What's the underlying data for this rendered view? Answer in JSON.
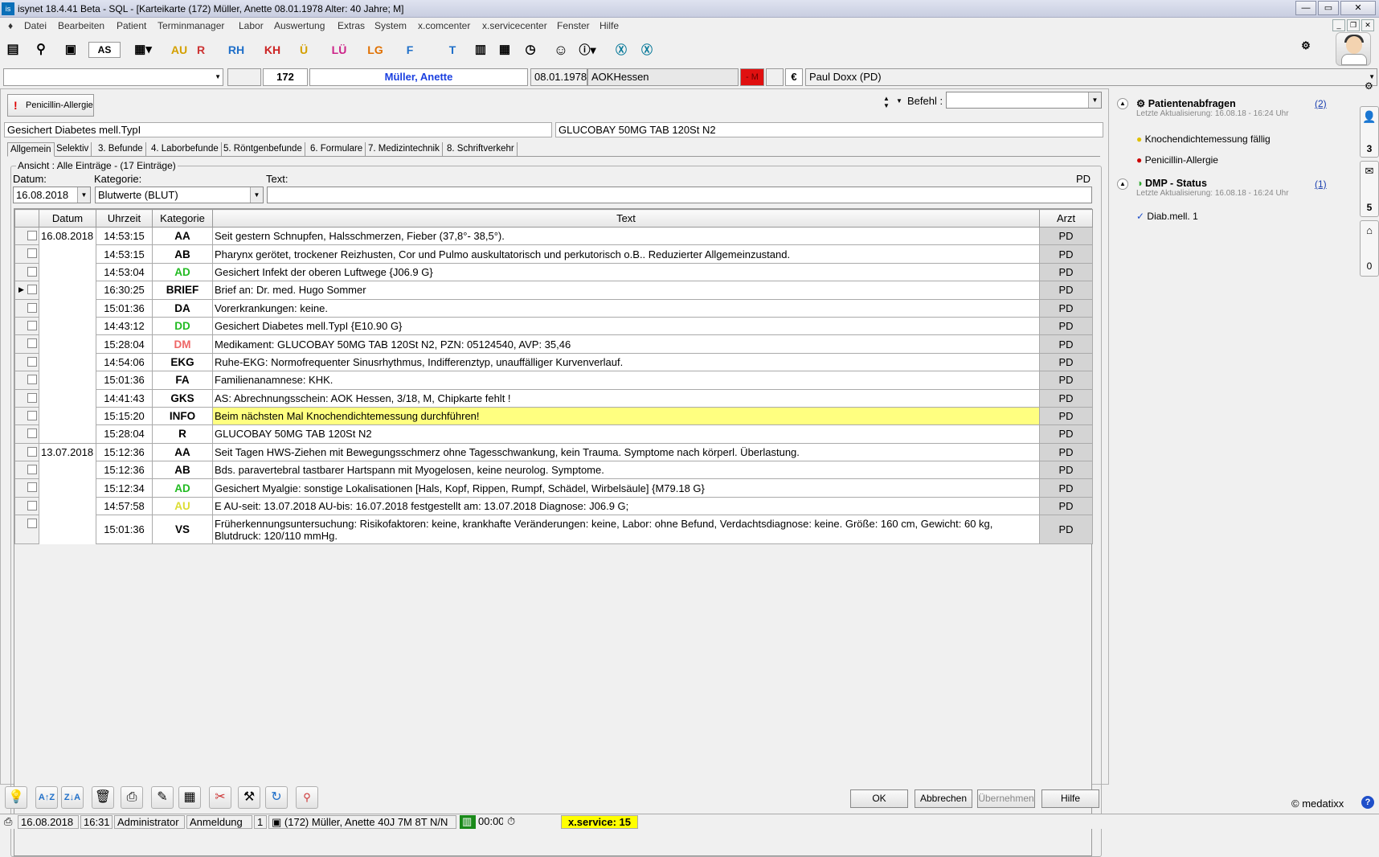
{
  "window": {
    "title": "isynet 18.4.41 Beta - SQL - [Karteikarte (172) Müller, Anette 08.01.1978 Alter: 40 Jahre; M]",
    "app_icon": "isynet-logo"
  },
  "menu": [
    "Datei",
    "Bearbeiten",
    "Patient",
    "Terminmanager",
    "Labor",
    "Auswertung",
    "Extras",
    "System",
    "x.comcenter",
    "x.servicecenter",
    "Fenster",
    "Hilfe"
  ],
  "toolbar": {
    "au": "AU",
    "r": "R",
    "rh": "RH",
    "kh": "KH",
    "u": "Ü",
    "lu": "LÜ",
    "lg": "LG",
    "f": "F",
    "as": "AS",
    "t": "T"
  },
  "patient": {
    "number": "172",
    "name": "Müller, Anette",
    "dob": "08.01.1978",
    "insurance": "AOKHessen",
    "sex_flag": "- M",
    "euro": "€",
    "doctor": "Paul Doxx (PD)"
  },
  "allergy_button": "Penicillin-Allergie",
  "befehl_label": "Befehl :",
  "diagnosis_left": "Gesichert Diabetes mell.TypI",
  "diagnosis_right": "GLUCOBAY 50MG TAB 120St N2",
  "tabs": [
    "Allgemein",
    "Selektiv",
    "3. Befunde",
    "4. Laborbefunde",
    "5. Röntgenbefunde",
    "6. Formulare",
    "7. Medizintechnik",
    "8. Schriftverkehr"
  ],
  "view_label": "Ansicht : Alle Einträge - (17 Einträge)",
  "filter": {
    "datum_label": "Datum:",
    "datum_value": "16.08.2018",
    "kategorie_label": "Kategorie:",
    "kategorie_value": "Blutwerte (BLUT)",
    "text_label": "Text:",
    "user_tag": "PD"
  },
  "table": {
    "headers": [
      "Datum",
      "Uhrzeit",
      "Kategorie",
      "Text",
      "Arzt"
    ],
    "rows": [
      {
        "date": "16.08.2018",
        "time": "14:53:15",
        "cat": "AA",
        "cat_color": "#000000",
        "text": "Seit gestern Schnupfen, Halsschmerzen, Fieber (37,8°- 38,5°).",
        "arzt": "PD"
      },
      {
        "date": "",
        "time": "14:53:15",
        "cat": "AB",
        "cat_color": "#000000",
        "text": "Pharynx gerötet, trockener Reizhusten, Cor und Pulmo auskultatorisch und perkutorisch o.B.. Reduzierter Allgemeinzustand.",
        "arzt": "PD"
      },
      {
        "date": "",
        "time": "14:53:04",
        "cat": "AD",
        "cat_color": "#22bb22",
        "text": "Gesichert Infekt der oberen Luftwege {J06.9 G}",
        "arzt": "PD"
      },
      {
        "date": "",
        "time": "16:30:25",
        "cat": "BRIEF",
        "cat_color": "#000000",
        "text": "Brief an: Dr. med. Hugo Sommer",
        "arzt": "PD"
      },
      {
        "date": "",
        "time": "15:01:36",
        "cat": "DA",
        "cat_color": "#000000",
        "text": "Vorerkrankungen: keine.",
        "arzt": "PD"
      },
      {
        "date": "",
        "time": "14:43:12",
        "cat": "DD",
        "cat_color": "#22bb22",
        "text": "Gesichert Diabetes mell.TypI {E10.90 G}",
        "arzt": "PD"
      },
      {
        "date": "",
        "time": "15:28:04",
        "cat": "DM",
        "cat_color": "#ee6666",
        "text": "Medikament: GLUCOBAY 50MG TAB 120St N2, PZN: 05124540, AVP:  35,46",
        "arzt": "PD"
      },
      {
        "date": "",
        "time": "14:54:06",
        "cat": "EKG",
        "cat_color": "#000000",
        "text": "Ruhe-EKG: Normofrequenter Sinusrhythmus, Indifferenztyp, unauffälliger Kurvenverlauf.",
        "arzt": "PD"
      },
      {
        "date": "",
        "time": "15:01:36",
        "cat": "FA",
        "cat_color": "#000000",
        "text": "Familienanamnese: KHK.",
        "arzt": "PD"
      },
      {
        "date": "",
        "time": "14:41:43",
        "cat": "GKS",
        "cat_color": "#000000",
        "text": "AS: Abrechnungsschein: AOK Hessen, 3/18, M, Chipkarte fehlt !",
        "arzt": "PD"
      },
      {
        "date": "",
        "time": "15:15:20",
        "cat": "INFO",
        "cat_color": "#000000",
        "text": "Beim nächsten Mal Knochendichtemessung durchführen!",
        "arzt": "PD"
      },
      {
        "date": "",
        "time": "15:28:04",
        "cat": "R",
        "cat_color": "#000000",
        "text": "GLUCOBAY 50MG TAB 120St N2",
        "arzt": "PD"
      },
      {
        "date": "13.07.2018",
        "time": "15:12:36",
        "cat": "AA",
        "cat_color": "#000000",
        "text": "Seit Tagen HWS-Ziehen mit Bewegungsschmerz ohne Tagesschwankung, kein Trauma. Symptome nach körperl. Überlastung.",
        "arzt": "PD"
      },
      {
        "date": "",
        "time": "15:12:36",
        "cat": "AB",
        "cat_color": "#000000",
        "text": "Bds. paravertebral tastbarer Hartspann mit Myogelosen, keine neurolog. Symptome.",
        "arzt": "PD"
      },
      {
        "date": "",
        "time": "15:12:34",
        "cat": "AD",
        "cat_color": "#22bb22",
        "text": "Gesichert Myalgie: sonstige Lokalisationen [Hals, Kopf, Rippen, Rumpf, Schädel, Wirbelsäule] {M79.18 G}",
        "arzt": "PD"
      },
      {
        "date": "",
        "time": "14:57:58",
        "cat": "AU",
        "cat_color": "#dddd33",
        "text": "E  AU-seit: 13.07.2018 AU-bis: 16.07.2018 festgestellt am: 13.07.2018 Diagnose: J06.9 G;",
        "arzt": "PD"
      },
      {
        "date": "",
        "time": "15:01:36",
        "cat": "VS",
        "cat_color": "#000000",
        "text": "Früherkennungsuntersuchung: Risikofaktoren: keine, krankhafte Veränderungen: keine, Labor: ohne Befund, Verdachtsdiagnose: keine. Größe: 160 cm, Gewicht: 60 kg, Blutdruck: 120/110 mmHg.",
        "arzt": "PD"
      }
    ]
  },
  "buttons": {
    "ok": "OK",
    "cancel": "Abbrechen",
    "apply": "Übernehmen",
    "help": "Hilfe"
  },
  "right_panel": {
    "abfragen": {
      "title": "Patientenabfragen",
      "count": "(2)",
      "updated": "Letzte Aktualisierung: 16.08.18 - 16:24 Uhr",
      "items": [
        "Knochendichtemessung fällig",
        "Penicillin-Allergie"
      ]
    },
    "dmp": {
      "title": "DMP - Status",
      "count": "(1)",
      "updated": "Letzte Aktualisierung: 16.08.18 - 16:24 Uhr",
      "items": [
        "Diab.mell. 1"
      ]
    },
    "brand": "© medatixx"
  },
  "side_counts": [
    "3",
    "5",
    "0"
  ],
  "statusbar": {
    "date": "16.08.2018",
    "time": "16:31",
    "user": "Administrator",
    "mode": "Anmeldung",
    "num": "1",
    "patient": "(172) Müller, Anette 40J 7M 8T N/N",
    "clock": "00:00",
    "service": "x.service: 15"
  }
}
